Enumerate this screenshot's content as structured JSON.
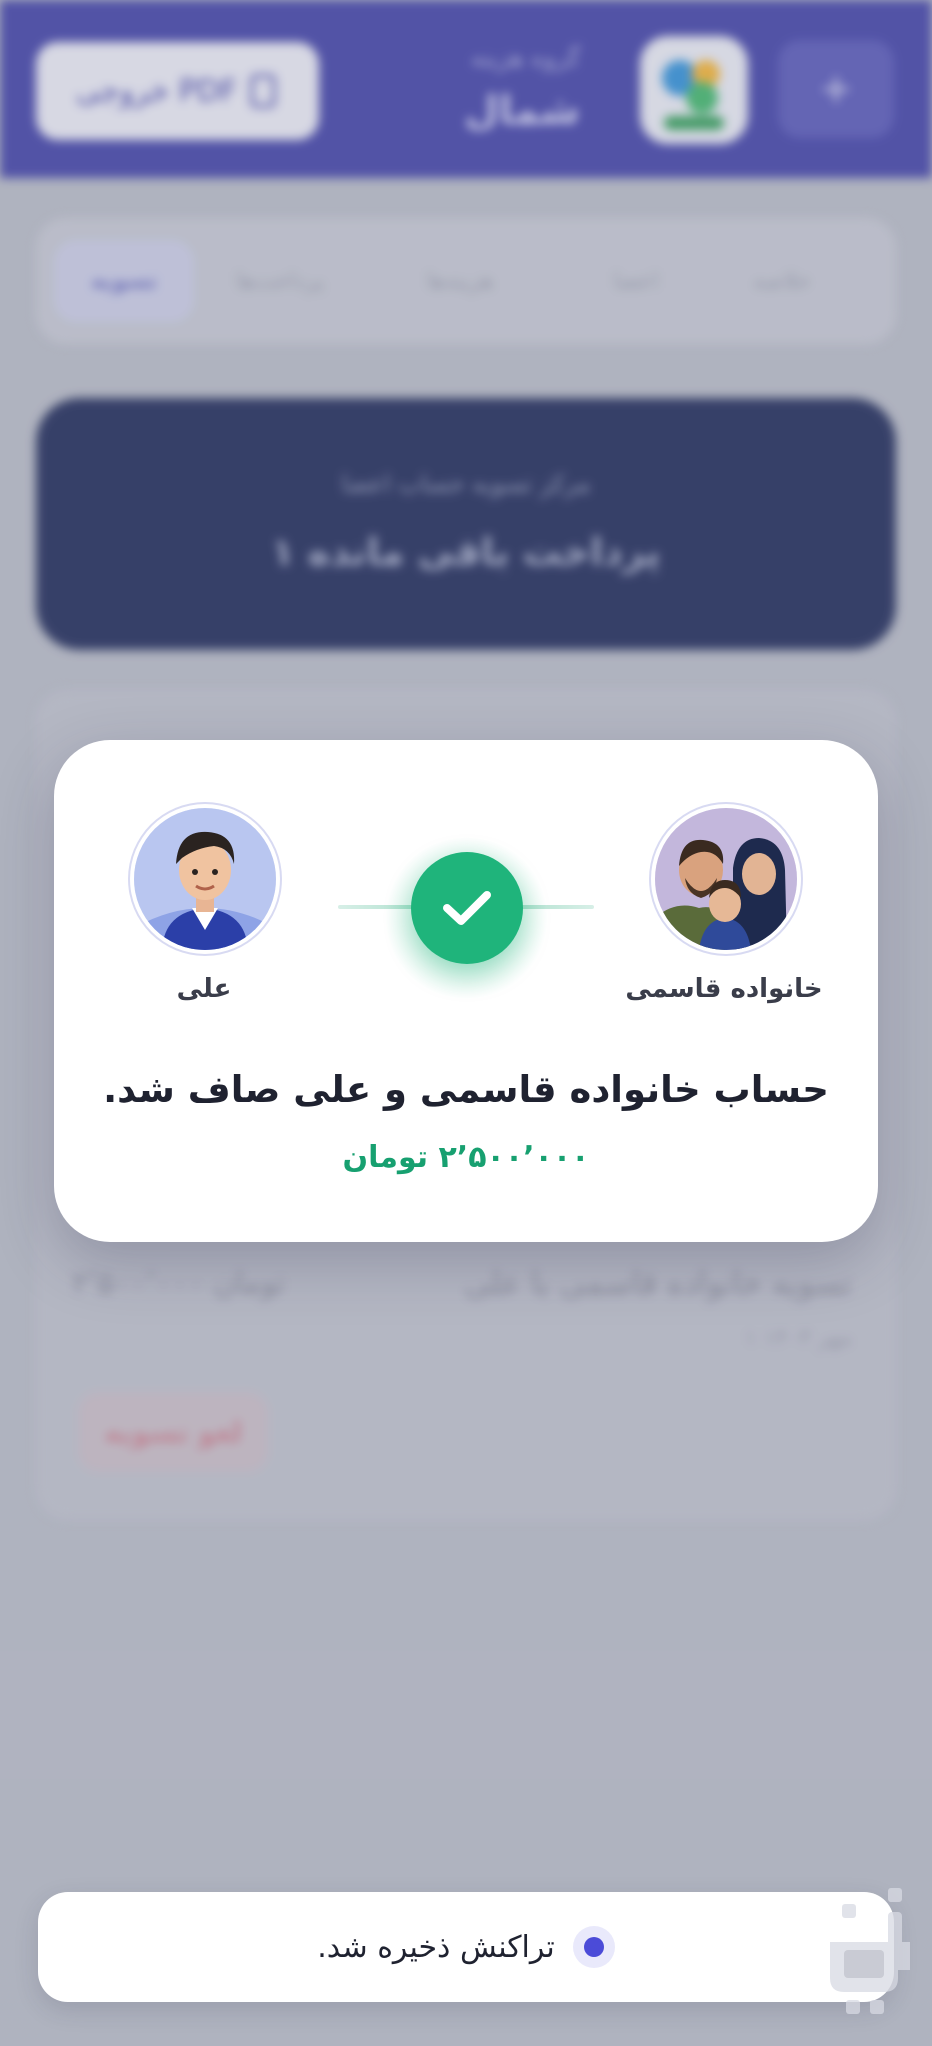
{
  "header": {
    "export_pdf_label": "خروجی PDF",
    "group_subtitle": "گروه هزینه",
    "group_name": "شمال",
    "add_button_label": "+"
  },
  "tabs": [
    "خلاصه",
    "اعضا",
    "هزینه‌ها",
    "پرداخت‌ها",
    "تسویه"
  ],
  "balance_card": {
    "label": "مرکز تسویه حساب اعضا",
    "remaining": "۱ پرداخت باقی مانده"
  },
  "settlement_row": {
    "title": "تسویه خانواده قاسمی با علی",
    "amount": "۲٬۵۰۰٬۰۰۰ تومان",
    "date": "۱ مهر ۱۴۰۳",
    "undo_label": "لغو تسویه"
  },
  "modal": {
    "from_name": "خانواده قاسمی",
    "to_name": "علی",
    "message": "حساب خانواده قاسمی و علی صاف شد.",
    "amount": "۲٬۵۰۰٬۰۰۰ تومان",
    "check_color": "#1fb47b"
  },
  "toast": {
    "text": "تراکنش ذخیره شد."
  },
  "colors": {
    "header": "#3f3fa6",
    "accent_green": "#17a070",
    "accent_indigo": "#4b4bd8",
    "card_dark": "#1c2757"
  }
}
